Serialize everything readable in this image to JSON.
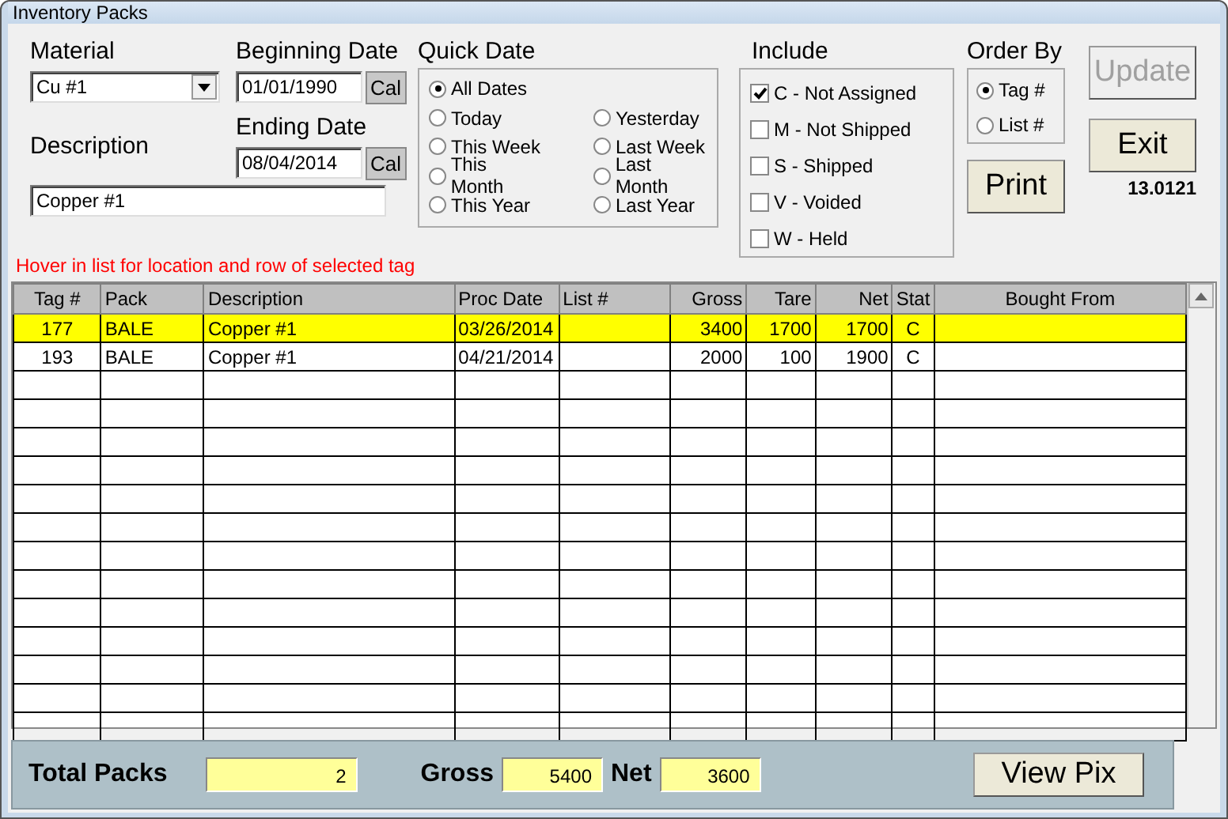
{
  "window": {
    "title": "Inventory Packs"
  },
  "material": {
    "label": "Material",
    "value": "Cu #1"
  },
  "beginning_date": {
    "label": "Beginning Date",
    "value": "01/01/1990",
    "button": "Cal"
  },
  "ending_date": {
    "label": "Ending Date",
    "value": "08/04/2014",
    "button": "Cal"
  },
  "description": {
    "label": "Description",
    "value": "Copper #1"
  },
  "quick_date": {
    "title": "Quick Date",
    "options_left": [
      {
        "label": "All Dates",
        "selected": true
      },
      {
        "label": "Today",
        "selected": false
      },
      {
        "label": "This Week",
        "selected": false
      },
      {
        "label": "This Month",
        "selected": false
      },
      {
        "label": "This Year",
        "selected": false
      }
    ],
    "options_right": [
      {
        "label": "Yesterday",
        "selected": false
      },
      {
        "label": "Last Week",
        "selected": false
      },
      {
        "label": "Last Month",
        "selected": false
      },
      {
        "label": "Last Year",
        "selected": false
      }
    ]
  },
  "include": {
    "title": "Include",
    "options": [
      {
        "label": "C - Not Assigned",
        "checked": true
      },
      {
        "label": "M - Not Shipped",
        "checked": false
      },
      {
        "label": "S - Shipped",
        "checked": false
      },
      {
        "label": "V - Voided",
        "checked": false
      },
      {
        "label": "W - Held",
        "checked": false
      }
    ]
  },
  "order_by": {
    "title": "Order By",
    "options": [
      {
        "label": "Tag #",
        "selected": true
      },
      {
        "label": "List #",
        "selected": false
      }
    ]
  },
  "buttons": {
    "update": {
      "label": "Update",
      "disabled": true
    },
    "print": {
      "label": "Print"
    },
    "exit": {
      "label": "Exit"
    }
  },
  "version": "13.0121",
  "hint": "Hover in list for location and row of selected tag",
  "table": {
    "columns": [
      "Tag #",
      "Pack",
      "Description",
      "Proc Date",
      "List #",
      "Gross",
      "Tare",
      "Net",
      "Stat",
      "Bought From"
    ],
    "rows": [
      {
        "selected": true,
        "cells": [
          "177",
          "BALE",
          "Copper #1",
          "03/26/2014",
          "",
          "3400",
          "1700",
          "1700",
          "C",
          ""
        ]
      },
      {
        "selected": false,
        "cells": [
          "193",
          "BALE",
          "Copper #1",
          "04/21/2014",
          "",
          "2000",
          "100",
          "1900",
          "C",
          ""
        ]
      }
    ]
  },
  "totals": {
    "packs_label": "Total Packs",
    "packs": "2",
    "gross_label": "Gross",
    "gross": "5400",
    "net_label": "Net",
    "net": "3600",
    "view_button": "View Pix"
  }
}
